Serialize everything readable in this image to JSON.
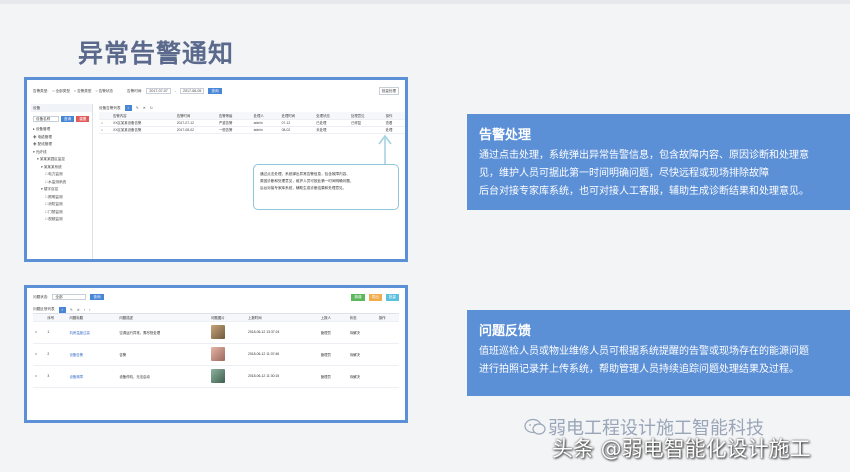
{
  "slide": {
    "title": "异常告警通知"
  },
  "screenshot1": {
    "filter_label": "告警类型:",
    "radio_opts": [
      "全部类型",
      "告警类型",
      "告警状态"
    ],
    "time_label": "告警时间:",
    "date_from": "2017-07-07",
    "date_to": "2017-08-05",
    "query_btn": "查询",
    "batch_btn": "批量处理",
    "sidebar_title": "设备",
    "sidebar_search_placeholder": "设备名称",
    "sidebar_btns": [
      "查询",
      "重置"
    ],
    "tree": [
      "设备管理",
      "电缆管理",
      "配线管理",
      "光纤线",
      "某某某园区监控",
      "某某某系统",
      "电力监测",
      "水监测系统",
      "楼宇自控",
      "照明监测",
      "消防监测",
      "门禁监测",
      "视频监测"
    ],
    "list_title": "设备告警列表",
    "headers": [
      "",
      "告警内容",
      "告警时间",
      "告警等级",
      "处理人",
      "处理时间",
      "处理状态",
      "处理意见",
      "操作"
    ],
    "rows": [
      [
        "",
        "XX区某某设备告警",
        "2017-07-12",
        "严重告警",
        "admin",
        "07-12",
        "已处理",
        "已修复",
        "查看"
      ],
      [
        "",
        "XX区某某设备告警",
        "2017-08-02",
        "一般告警",
        "admin",
        "08-02",
        "未处理",
        "",
        "处理"
      ]
    ],
    "callout_lines": [
      "通过点击处理，系统弹出异常告警信息，包含故障内容、",
      "原因诊断和处理意见，维护人员可按此第一时间明确问题，",
      "后台对接专家库系统，辅助生成诊断结果和处理意见。"
    ]
  },
  "screenshot2": {
    "filter_label": "问题状态:",
    "filter_value": "全部",
    "query_btn": "查询",
    "action_btns": [
      "新增",
      "导出",
      "批量"
    ],
    "list_title": "问题反馈列表",
    "headers": [
      "",
      "序号",
      "问题标题",
      "问题描述",
      "问题图片",
      "上报时间",
      "上报人",
      "状态",
      "操作"
    ],
    "rows": [
      [
        "",
        "1",
        "机房温度过高",
        "空调运行异常，需尽快处理",
        "",
        "2018-06-12 13:37:24",
        "管理员",
        "待解决",
        ""
      ],
      [
        "",
        "2",
        "设备告警",
        "告警",
        "",
        "2018-06-12 11:37:46",
        "管理员",
        "待解决",
        ""
      ],
      [
        "",
        "3",
        "设备故障",
        "设备停机，无法启动",
        "",
        "2018-06-12 11:30:15",
        "管理员",
        "待解决",
        ""
      ]
    ]
  },
  "panel1": {
    "title": "告警处理",
    "lines": [
      "通过点击处理，系统弹出异常告警信息，包含故障内容、原因诊断和处理意",
      "见，维护人员可据此第一时间明确问题，尽快远程或现场排除故障",
      "后台对接专家库系统，也可对接人工客服，辅助生成诊断结果和处理意见。"
    ]
  },
  "panel2": {
    "title": "问题反馈",
    "lines": [
      "值班巡检人员或物业维修人员可根据系统提醒的告警或现场存在的能源问题",
      "进行拍照记录并上传系统，帮助管理人员持续追踪问题处理结果及过程。"
    ]
  },
  "watermark": {
    "line1": "弱电工程设计施工智能科技",
    "line2": "头条 @弱电智能化设计施工"
  },
  "colors": {
    "accent": "#5b8fd6",
    "title": "#5b6a8c"
  }
}
